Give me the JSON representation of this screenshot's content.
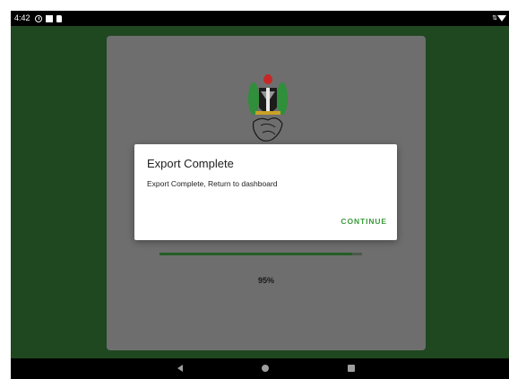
{
  "status_bar": {
    "time": "4:42",
    "left_icons": [
      "alarm-clock-icon",
      "notification-square-icon",
      "sd-card-icon"
    ],
    "right_icons": [
      "data-transfer-icon",
      "wifi-icon"
    ]
  },
  "app": {
    "emblem": "nigeria-coat-of-arms-logo",
    "progress": {
      "percent": 95,
      "label": "95%"
    }
  },
  "dialog": {
    "title": "Export Complete",
    "message": "Export Complete, Return to dashboard",
    "continue_label": "CONTINUE"
  },
  "nav_bar": {
    "buttons": [
      "back-icon",
      "home-icon",
      "recents-icon"
    ]
  },
  "colors": {
    "background": "#1f4720",
    "accent": "#3d9a3d",
    "progress": "#255e25",
    "card": "#6e6e6e"
  }
}
